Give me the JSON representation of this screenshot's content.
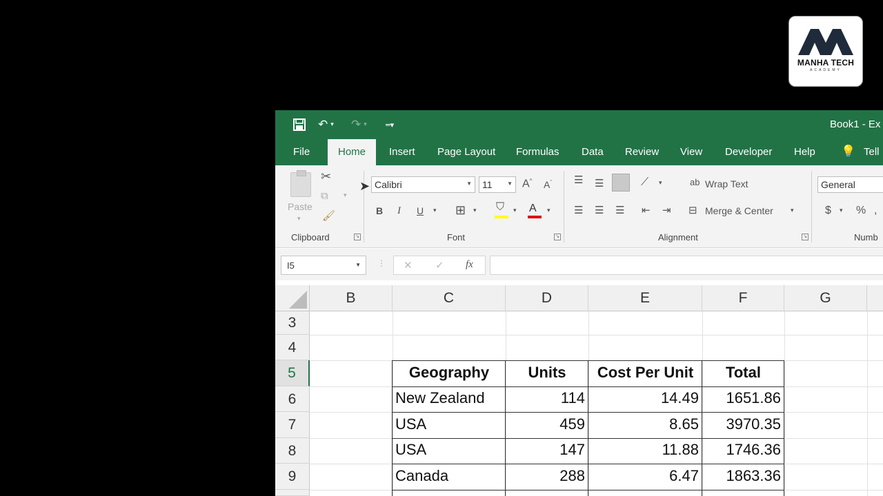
{
  "logo": {
    "brand": "MANHA TECH",
    "sub": "ACADEMY"
  },
  "window": {
    "title": "Book1 - Ex"
  },
  "tabs": [
    "File",
    "Home",
    "Insert",
    "Page Layout",
    "Formulas",
    "Data",
    "Review",
    "View",
    "Developer",
    "Help",
    "Tell"
  ],
  "ribbon": {
    "clipboard": {
      "paste_label": "Paste",
      "group_label": "Clipboard"
    },
    "font": {
      "font_name": "Calibri",
      "font_size": "11",
      "bold": "B",
      "italic": "I",
      "underline": "U",
      "group_label": "Font"
    },
    "alignment": {
      "wrap_text": "Wrap Text",
      "merge_center": "Merge & Center",
      "group_label": "Alignment"
    },
    "number": {
      "format": "General",
      "currency": "$",
      "percent": "%",
      "group_label": "Numb"
    }
  },
  "formula_bar": {
    "name_box": "I5",
    "fx": "fx",
    "formula": ""
  },
  "columns": [
    "B",
    "C",
    "D",
    "E",
    "F",
    "G"
  ],
  "rows": [
    "3",
    "4",
    "5",
    "6",
    "7",
    "8",
    "9"
  ],
  "table": {
    "headers": [
      "Geography",
      "Units",
      "Cost Per Unit",
      "Total"
    ],
    "rows": [
      [
        "New Zealand",
        "114",
        "14.49",
        "1651.86"
      ],
      [
        "USA",
        "459",
        "8.65",
        "3970.35"
      ],
      [
        "USA",
        "147",
        "11.88",
        "1746.36"
      ],
      [
        "Canada",
        "288",
        "6.47",
        "1863.36"
      ]
    ]
  },
  "colors": {
    "excel_green": "#217346",
    "ribbon_bg": "#f3f3f3"
  }
}
